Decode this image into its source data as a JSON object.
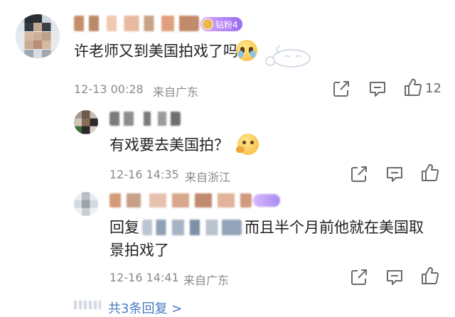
{
  "comments": [
    {
      "text": "许老师又到美国拍戏了吗",
      "badge": "钻粉4",
      "date": "12-13 00:28",
      "location": "来自广东",
      "like_count": "12"
    },
    {
      "text": "有戏要去美国拍？",
      "date": "12-16 14:35",
      "location": "来自浙江"
    },
    {
      "reply_prefix": "回复",
      "text_line1": "而且半个月前他就在美国取",
      "text_line2": "景拍戏了",
      "date": "12-16 14:41",
      "location": "来自广东"
    }
  ],
  "view_replies": "共3条回复 >",
  "icons": {
    "share": "share-icon",
    "comment": "comment-icon",
    "like": "thumbs-up-icon"
  },
  "colors": {
    "link": "#4a78c2",
    "meta": "#8a8a8a",
    "badge": "#a77cf2"
  }
}
